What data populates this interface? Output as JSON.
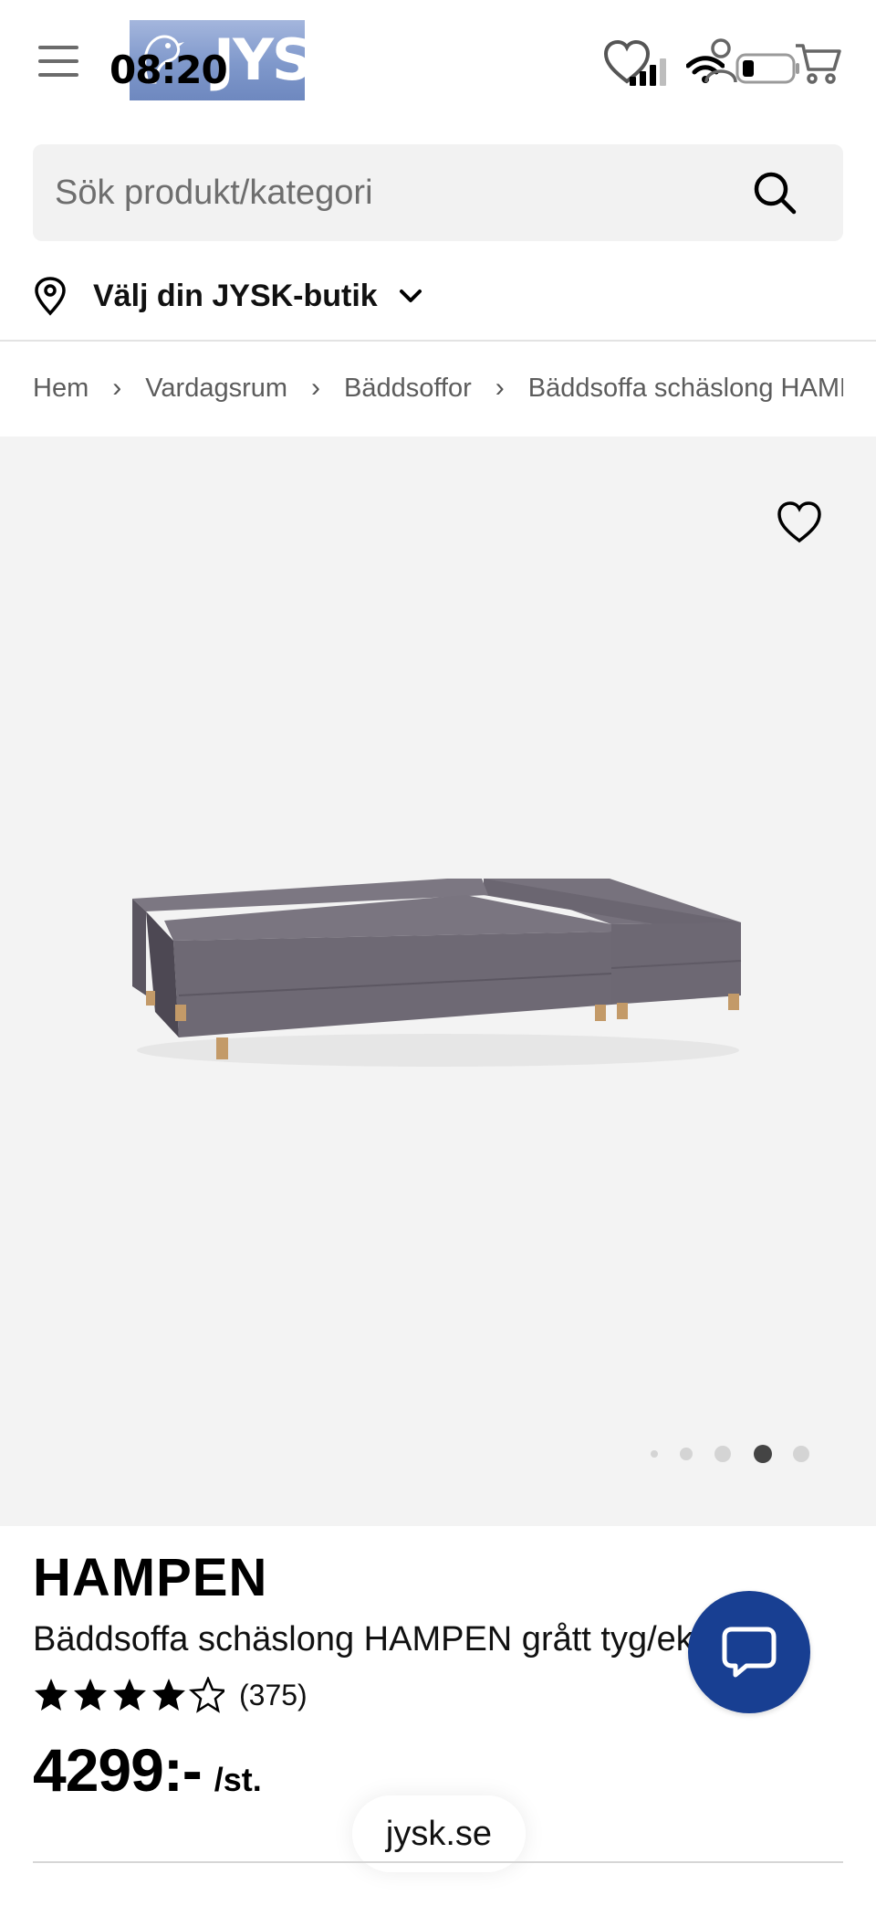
{
  "status_bar": {
    "time": "08:20"
  },
  "header": {
    "logo_text": "JYSK",
    "icons": [
      "menu-icon",
      "heart-icon",
      "user-icon",
      "cart-icon"
    ]
  },
  "search": {
    "placeholder": "Sök produkt/kategori"
  },
  "store": {
    "label": "Välj din JYSK-butik"
  },
  "breadcrumb": [
    {
      "label": "Hem"
    },
    {
      "label": "Vardagsrum"
    },
    {
      "label": "Bäddsoffor"
    },
    {
      "label": "Bäddsoffa schäslong HAMPEN"
    }
  ],
  "gallery": {
    "image_count": 5,
    "active_index": 3
  },
  "product": {
    "title": "HAMPEN",
    "description": "Bäddsoffa schäslong HAMPEN grått tyg/ek färgad",
    "rating": 4,
    "rating_max": 5,
    "review_count": "(375)",
    "price": "4299:-",
    "price_unit": "/st."
  },
  "browser": {
    "url": "jysk.se"
  },
  "colors": {
    "brand_blue": "#183f92",
    "logo_blue": "#7f98cb",
    "gallery_bg": "#f3f3f3"
  }
}
